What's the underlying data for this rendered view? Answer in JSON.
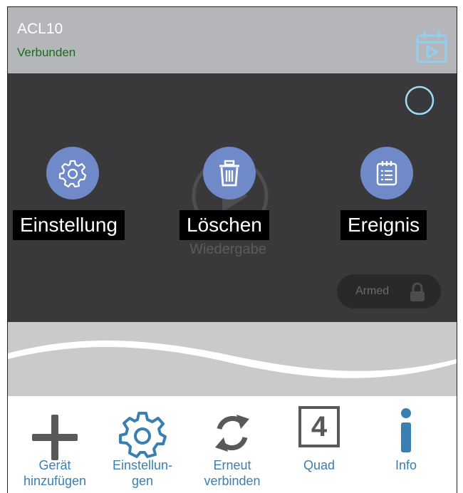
{
  "header": {
    "device_name": "ACL10",
    "status": "Verbunden",
    "playback_icon": "calendar-play-icon"
  },
  "video": {
    "watermark_label": "Wiedergabe",
    "actions": [
      {
        "label": "Einstellung",
        "icon": "gear-icon"
      },
      {
        "label": "Löschen",
        "icon": "trash-icon"
      },
      {
        "label": "Ereignis",
        "icon": "event-list-icon"
      }
    ],
    "armed_label": "Armed"
  },
  "toolbar": {
    "items": [
      {
        "line1": "Gerät",
        "line2": "hinzufügen",
        "icon": "plus-icon"
      },
      {
        "line1": "Einstellun-",
        "line2": "gen",
        "icon": "gear-icon"
      },
      {
        "line1": "Erneut",
        "line2": "verbinden",
        "icon": "refresh-icon"
      },
      {
        "line1": "Quad",
        "line2": "",
        "icon": "quad-icon",
        "quad_digit": "4"
      },
      {
        "line1": "Info",
        "line2": "",
        "icon": "info-icon"
      }
    ]
  },
  "colors": {
    "header_bg": "#b4b6b9",
    "video_bg": "#39383a",
    "action_blue": "#6f89c9",
    "status_green": "#1e6b1e",
    "toolbar_blue": "#3a7fb1",
    "toolbar_gray": "#58595b"
  }
}
